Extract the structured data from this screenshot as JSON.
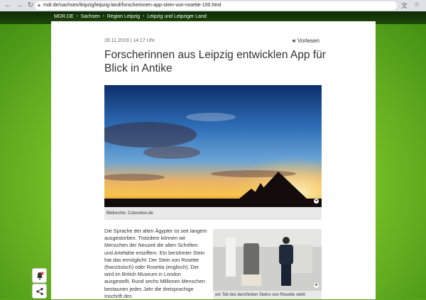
{
  "browser": {
    "url": "mdr.de/sachsen/leipzig/leipzig-land/forscherinnen-app-stein-von-rosette-100.html",
    "icons": [
      "back-icon",
      "forward-icon",
      "reload-icon",
      "lock-icon",
      "translate-icon",
      "star-icon"
    ]
  },
  "breadcrumb": [
    "MDR.DE",
    "Sachsen",
    "Region Leipzig",
    "Leipzig und Leipziger Land"
  ],
  "article": {
    "meta": "28.11.2019 | 14:17 Uhr",
    "read_aloud": "Vorlesen",
    "title": "Forscherinnen aus Leipzig entwicklen App für Blick in Antike",
    "hero_caption": "Bildrechte: Colourbox.de",
    "body": "Die Sprache der alten Ägypter ist seit langem ausgestorben. Trotzdem können wir Menschen der Neuzeit die alten Schriften und Artefakte entziffern. Ein berühmter Stein hat das ermöglicht: Der Stein von Rosette (französisch) oder Rosetta (englisch). Der wird im British Museum in London ausgestellt. Rund sechs Millionen Menschen bestaunen jedes Jahr die dreisprachige Inschrift des",
    "thumb_caption": "ein Teil des berühmten Steins von Rosette steht"
  },
  "colors": {
    "brand_green": "#5aa71a",
    "dark_band": "#0d2a05",
    "text": "#333333"
  }
}
